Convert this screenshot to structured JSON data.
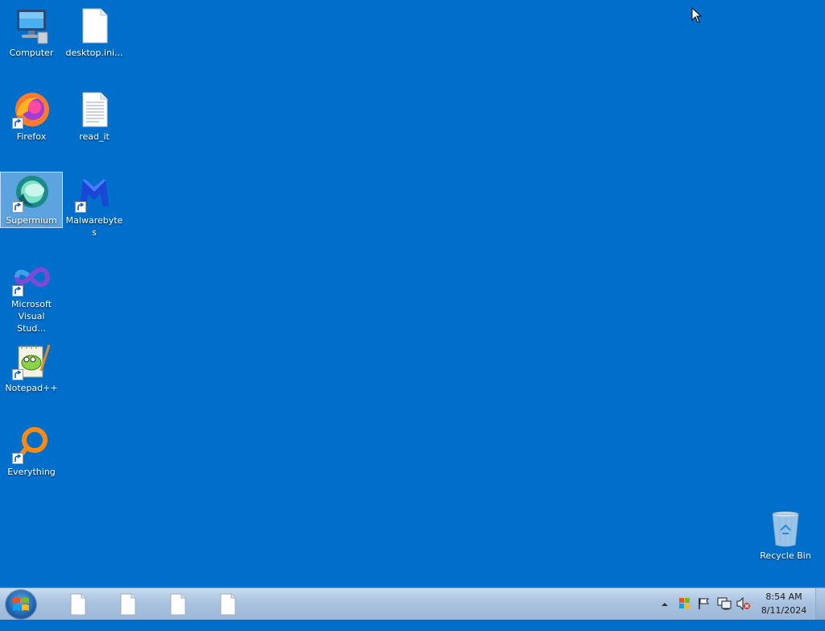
{
  "desktop": {
    "icons": [
      {
        "label": "Computer",
        "icon": "computer-icon"
      },
      {
        "label": "desktop.ini...",
        "icon": "file-icon"
      },
      {
        "label": "Firefox",
        "icon": "firefox-icon"
      },
      {
        "label": "read_it",
        "icon": "text-file-icon"
      },
      {
        "label": "Supermium",
        "icon": "supermium-icon",
        "selected": true
      },
      {
        "label": "Malwarebytes",
        "icon": "malwarebytes-icon"
      },
      {
        "label": "Microsoft Visual Stud...",
        "icon": "visual-studio-icon"
      },
      {
        "label": "Notepad++",
        "icon": "notepadpp-icon"
      },
      {
        "label": "Everything",
        "icon": "everything-icon"
      },
      {
        "label": "Recycle Bin",
        "icon": "recycle-bin-icon"
      }
    ]
  },
  "taskbar": {
    "start_icon": "windows-logo-icon",
    "items": [
      "file-icon",
      "file-icon",
      "file-icon",
      "file-icon"
    ],
    "tray": [
      "show-hidden-icons-arrow",
      "windows-flag-icon",
      "action-center-flag-icon",
      "network-icon",
      "volume-muted-icon"
    ],
    "clock": {
      "time": "8:54 AM",
      "date": "8/11/2024"
    }
  },
  "colors": {
    "desktop_bg": "#006fcb",
    "taskbar_bg": "#a9c3e0"
  }
}
